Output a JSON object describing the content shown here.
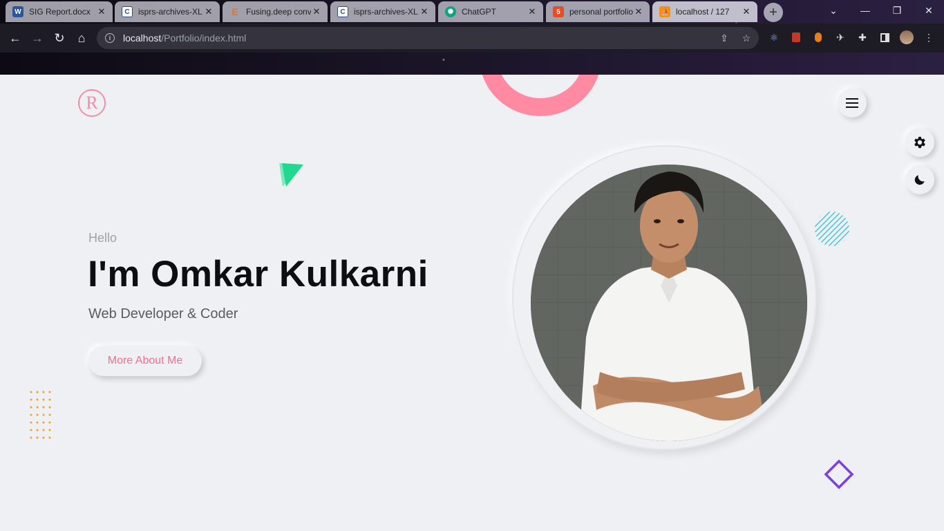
{
  "browser": {
    "tabs": [
      {
        "title": "SIG Report.docx",
        "favicon": "word-icon",
        "color": "#2b579a"
      },
      {
        "title": "isprs-archives-XL",
        "favicon": "copernicus-icon",
        "color": "#2a4d8f"
      },
      {
        "title": "Fusing.deep conv",
        "favicon": "elsevier-icon",
        "color": "#e9711c"
      },
      {
        "title": "isprs-archives-XL",
        "favicon": "copernicus-icon",
        "color": "#2a4d8f"
      },
      {
        "title": "ChatGPT",
        "favicon": "chatgpt-icon",
        "color": "#10a37f"
      },
      {
        "title": "personal portfolio",
        "favicon": "html5-icon",
        "color": "#e44d26"
      },
      {
        "title": "localhost / 127",
        "favicon": "phpmyadmin-icon",
        "color": "#f29111"
      }
    ],
    "new_tab_label": "+",
    "window_controls": {
      "dropdown": "⌄",
      "minimize": "—",
      "restore": "❐",
      "close": "✕"
    },
    "url_host": "localhost",
    "url_path": "/Portfolio/index.html"
  },
  "page": {
    "logo_letter": "R",
    "greeting": "Hello",
    "name": "I'm Omkar Kulkarni",
    "role": "Web Developer & Coder",
    "cta_label": "More About Me",
    "colors": {
      "accent_pink": "#ff8aa1",
      "button_text": "#f06d8d",
      "triangle_green": "#1ed98f",
      "dots_orange": "#f4a024",
      "stripes_cyan": "#39c4dc",
      "diamond_purple": "#7b3fe4",
      "background": "#eff0f4"
    },
    "icons": [
      "hamburger-menu-icon",
      "gear-icon",
      "moon-icon"
    ]
  }
}
